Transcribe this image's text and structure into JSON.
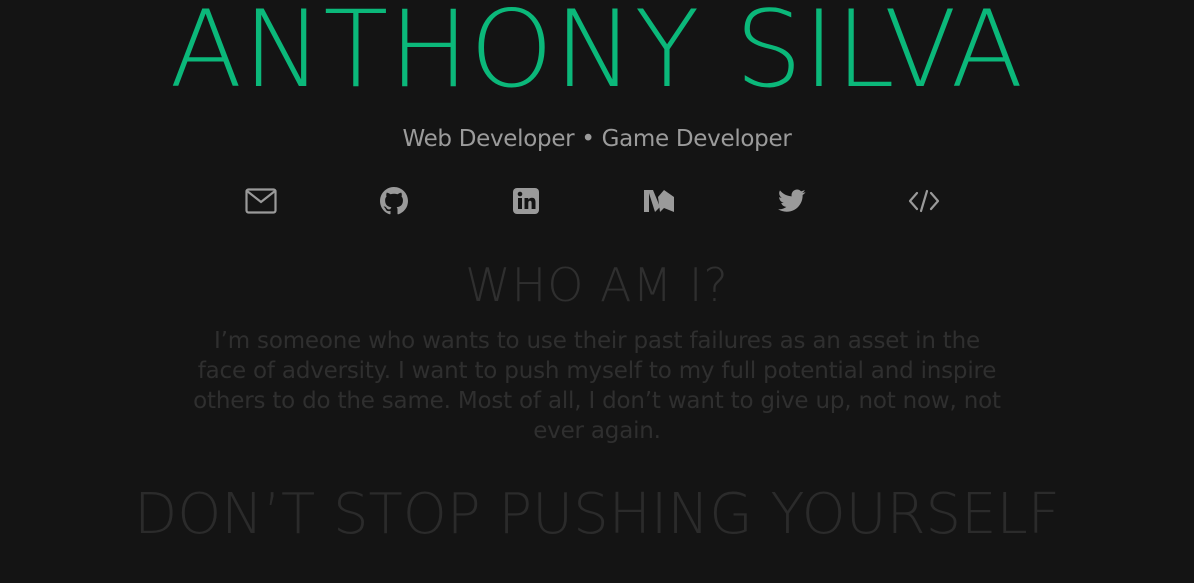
{
  "header": {
    "name": "ANTHONY SILVA",
    "subtitle": "Web Developer • Game Developer"
  },
  "social_links": [
    {
      "icon": "envelope-icon",
      "label": "email"
    },
    {
      "icon": "github-icon",
      "label": "github"
    },
    {
      "icon": "linkedin-icon",
      "label": "linkedin"
    },
    {
      "icon": "medium-icon",
      "label": "medium"
    },
    {
      "icon": "twitter-icon",
      "label": "twitter"
    },
    {
      "icon": "code-icon",
      "label": "code"
    }
  ],
  "about": {
    "title": "WHO AM I?",
    "text": "I’m someone who wants to use their past failures as an asset in the face of adversity. I want to push myself to my full potential and inspire others to do the same. Most of all, I don’t want to give up, not now, not ever again."
  },
  "motto": "DON’T STOP PUSHING YOURSELF",
  "colors": {
    "background": "#141414",
    "accent": "#0bb87a",
    "icon": "#9a9a9a",
    "faded_text": "#2f2f2f"
  }
}
